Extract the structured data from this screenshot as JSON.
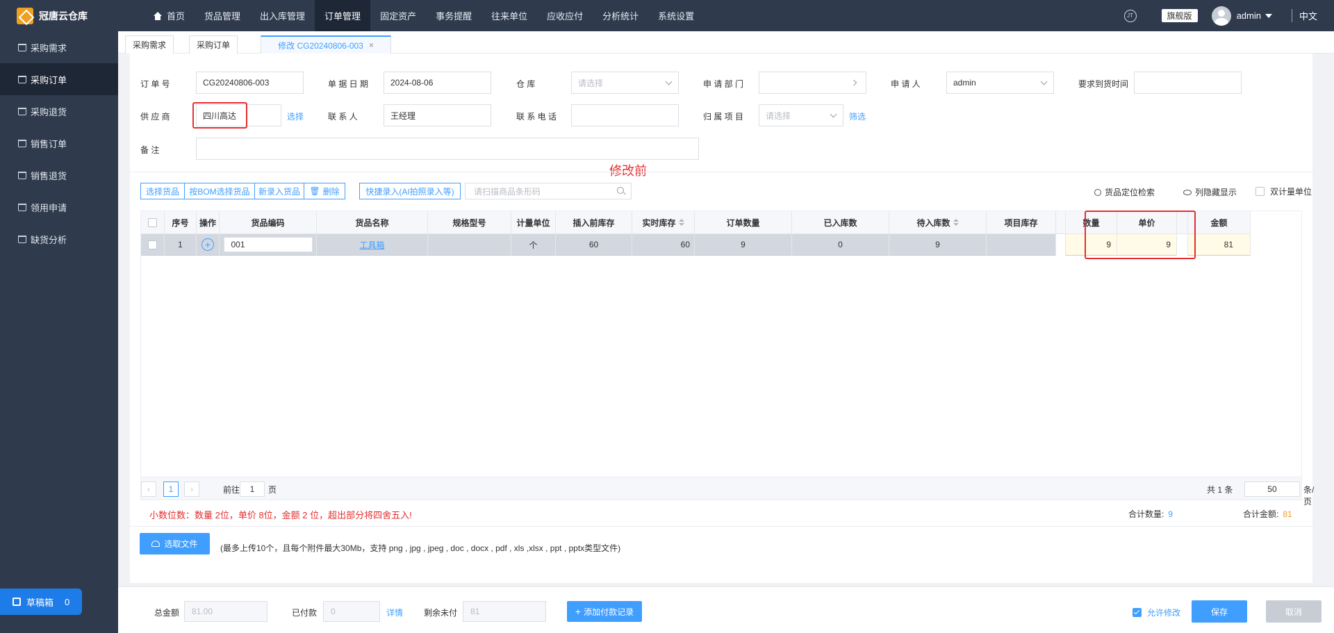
{
  "app": {
    "name": "冠唐云仓库"
  },
  "nav": {
    "items": [
      "首页",
      "货品管理",
      "出入库管理",
      "订单管理",
      "固定资产",
      "事务提醒",
      "往来单位",
      "应收应付",
      "分析统计",
      "系统设置"
    ],
    "active_index": 3
  },
  "header": {
    "edition": "旗舰版",
    "user": "admin",
    "lang": "中文"
  },
  "sidebar": {
    "items": [
      "采购需求",
      "采购订单",
      "采购退货",
      "销售订单",
      "销售退货",
      "领用申请",
      "缺货分析"
    ],
    "active_index": 1,
    "draft_label": "草稿箱",
    "draft_count": "0"
  },
  "tabs": [
    "采购需求",
    "采购订单",
    "修改 CG20240806-003"
  ],
  "form": {
    "order_no_label": "订 单 号",
    "order_no": "CG20240806-003",
    "date_label": "单 据 日 期",
    "date": "2024-08-06",
    "warehouse_label": "仓 库",
    "warehouse_ph": "请选择",
    "dept_label": "申 请 部 门",
    "applicant_label": "申 请 人",
    "applicant": "admin",
    "arrival_label": "要求到货时间",
    "supplier_label": "供 应 商",
    "supplier": "四川高达",
    "select_link": "选择",
    "contact_label": "联 系 人",
    "contact": "王经理",
    "phone_label": "联 系 电 话",
    "project_label": "归 属 项 目",
    "project_ph": "请选择",
    "filter_link": "筛选",
    "remark_label": "备 注"
  },
  "annotation": "修改前",
  "toolbar": {
    "buttons": [
      "选择货品",
      "按BOM选择货品",
      "新录入货品",
      "删除",
      "快捷录入(AI拍照录入等)"
    ],
    "scan_placeholder": "请扫描商品条形码",
    "locate": "货品定位检索",
    "hide_cols": "列隐藏显示",
    "dual_unit": "双计量单位"
  },
  "table": {
    "headers": [
      "序号",
      "操作",
      "货品编码",
      "货品名称",
      "规格型号",
      "计量单位",
      "插入前库存",
      "实时库存",
      "订单数量",
      "已入库数",
      "待入库数",
      "项目库存",
      "数量",
      "单价",
      "金额"
    ],
    "rows": [
      {
        "seq": "1",
        "code": "001",
        "name": "工具箱",
        "spec": "",
        "unit": "个",
        "stock_before": "60",
        "stock_now": "60",
        "order_qty": "9",
        "in_qty": "0",
        "pending_qty": "9",
        "project_stock": "",
        "qty": "9",
        "price": "9",
        "amount": "81"
      }
    ]
  },
  "pager": {
    "current": "1",
    "goto_label": "前往",
    "goto_value": "1",
    "page_label": "页",
    "total_text": "共 1 条",
    "page_size": "50",
    "size_unit": "条/页"
  },
  "precision_note": "小数位数：数量 2位，单价 8位，金额 2 位，超出部分将四舍五入!",
  "totals": {
    "qty_label": "合计数量:",
    "qty": "9",
    "amount_label": "合计金额:",
    "amount": "81"
  },
  "upload": {
    "button": "选取文件",
    "tip": "(最多上传10个，且每个附件最大30Mb，支持 png , jpg , jpeg , doc , docx , pdf , xls ,xlsx , ppt , pptx类型文件)"
  },
  "footer": {
    "total_label": "总金额",
    "total": "81.00",
    "paid_label": "已付款",
    "paid": "0",
    "detail_link": "详情",
    "unpaid_label": "剩余未付",
    "unpaid": "81",
    "add_payment": "添加付款记录",
    "allow_edit": "允许修改",
    "save": "保存",
    "cancel": "取消"
  },
  "colors": {
    "primary": "#409eff",
    "sidebar": "#2f3a4d",
    "danger": "#e62e2e",
    "orange": "#f59a23"
  }
}
